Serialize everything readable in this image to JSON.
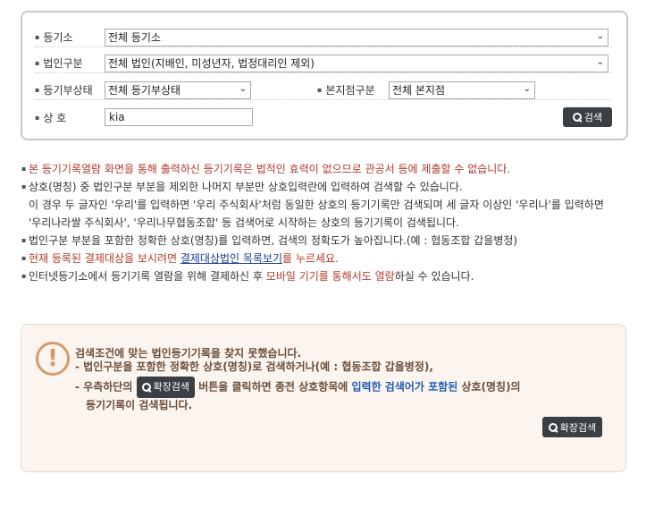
{
  "search": {
    "registry_label": "등기소",
    "registry_value": "전체 등기소",
    "corp_type_label": "법인구분",
    "corp_type_value": "전체 법인(지배인, 미성년자, 법정대리인 제외)",
    "status_label": "등기부상태",
    "status_value": "전체 등기부상태",
    "branch_label": "본지점구분",
    "branch_value": "전체 본지점",
    "name_label": "상 호",
    "name_value": "kia",
    "search_button": "검색"
  },
  "notes": {
    "n1": "본 등기기록열람 화면을 통해 출력하신 등기기록은 법적인 효력이 없으므로 관공서 등에 제출할 수 없습니다.",
    "n2": "상호(명칭) 중 법인구분 부분을 제외한 나머지 부분만 상호입력란에 입력하여 검색할 수 있습니다.",
    "n2b": "이 경우 두 글자인 '우리'를 입력하면 '우리 주식회사'처럼 동일한 상호의 등기기록만 검색되며 세 글자 이상인 '우리나'를 입력하면",
    "n2c": "'우리나라쌀 주식회사', '우리나무협동조합' 등 검색어로 시작하는 상호의 등기기록이 검색됩니다.",
    "n3": "법인구분 부분을 포함한 정확한 상호(명칭)를 입력하면, 검색의 정확도가 높아집니다.(예 : 협동조합 갑을병정)",
    "n4_pre": "현재 등록된 결제대상을 보시려면 ",
    "n4_link": "결제대상법인 목록보기",
    "n4_post": "를 누르세요.",
    "n5_pre": "인터넷등기소에서 등기기록 열람을 위해 결제하신 후 ",
    "n5_red": "모바일 기기를 통해서도 열람",
    "n5_post": "하실 수 있습니다."
  },
  "result": {
    "title": "검색조건에 맞는 법인등기기록을 찾지 못했습니다.",
    "line1": "- 법인구분을 포함한 정확한 상호(명칭)로 검색하거나(예 : 협동조합 갑을병정),",
    "line2_pre": "- 우측하단의 ",
    "chip_label": "확장검색",
    "line2_mid": " 버튼을 클릭하면 종전 상호항목에 ",
    "line2_blue": "입력한 검색어가 포함된",
    "line2_post": " 상호(명칭)의",
    "line3": "등기기록이 검색됩니다.",
    "extended_button": "확장검색"
  },
  "colors": {
    "accent_red": "#b23a2a",
    "link_blue": "#1a3d8f",
    "warn_orange": "#d49a6a",
    "button_dark": "#3a3f44"
  }
}
